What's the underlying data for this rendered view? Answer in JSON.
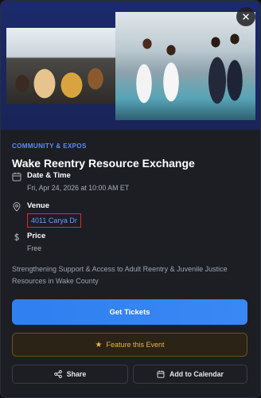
{
  "event": {
    "category": "COMMUNITY & EXPOS",
    "title": "Wake Reentry Resource Exchange",
    "date_time": {
      "label": "Date & Time",
      "value": "Fri, Apr 24, 2026 at 10:00 AM ET"
    },
    "venue": {
      "label": "Venue",
      "value": "4011 Carya Dr"
    },
    "price": {
      "label": "Price",
      "value": "Free"
    },
    "description": "Strengthening Support & Access to Adult Reentry & Juvenile Justice Resources in Wake County"
  },
  "actions": {
    "get_tickets": "Get Tickets",
    "feature": "Feature this Event",
    "share": "Share",
    "add_to_calendar": "Add to Calendar"
  },
  "colors": {
    "accent_blue": "#2f7ff0",
    "link_blue": "#6f98ff",
    "feature_gold": "#e8b447",
    "highlight_red": "#d32f2f"
  },
  "icons": {
    "close": "close-icon",
    "date": "calendar-icon",
    "venue": "map-pin-icon",
    "price": "dollar-icon",
    "feature": "star-icon",
    "share": "share-icon",
    "calendar": "calendar-icon"
  }
}
